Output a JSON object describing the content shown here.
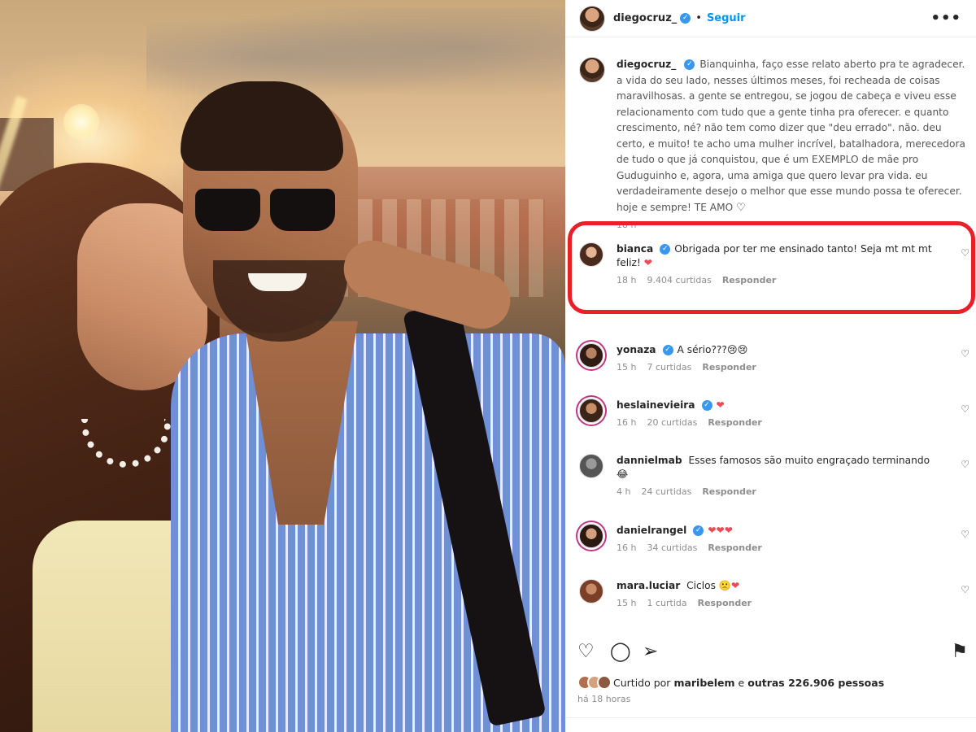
{
  "post": {
    "author": "diegocruz_",
    "follow_label": "Seguir",
    "separator": "•",
    "more": "•••",
    "caption": {
      "username": "diegocruz_",
      "text": "Bianquinha, faço esse relato aberto pra te agradecer. a vida do seu lado, nesses últimos meses, foi recheada de coisas maravilhosas. a gente se entregou, se jogou de cabeça e viveu esse relacionamento com tudo que a gente tinha pra oferecer. e quanto crescimento, né? não tem como dizer que \"deu errado\". não. deu certo, e muito! te acho uma mulher incrível, batalhadora, merecedora de tudo o que já conquistou, que é um EXEMPLO de mãe pro Guduguinho e, agora, uma amiga que quero levar pra vida. eu verdadeiramente desejo o melhor que esse mundo possa te oferecer. hoje e sempre! TE AMO",
      "heart": "♡",
      "time": "18 h"
    }
  },
  "comments": [
    {
      "username": "bianca",
      "verified": true,
      "text": "Obrigada por ter me ensinado tanto! Seja mt mt mt feliz!",
      "emoji": "❤",
      "time": "18 h",
      "likes": "9.404 curtidas",
      "reply": "Responder"
    },
    {
      "username": "yonaza",
      "verified": true,
      "text": "A sério???",
      "emoji": "😢😢",
      "time": "15 h",
      "likes": "7 curtidas",
      "reply": "Responder"
    },
    {
      "username": "heslainevieira",
      "verified": true,
      "text": "",
      "emoji": "❤",
      "time": "16 h",
      "likes": "20 curtidas",
      "reply": "Responder"
    },
    {
      "username": "dannielmab",
      "verified": false,
      "text": "Esses famosos são muito engraçado terminando",
      "emoji": "😂",
      "time": "4 h",
      "likes": "24 curtidas",
      "reply": "Responder"
    },
    {
      "username": "danielrangel",
      "verified": true,
      "text": "",
      "emoji": "❤❤❤",
      "time": "16 h",
      "likes": "34 curtidas",
      "reply": "Responder"
    },
    {
      "username": "mara.luciar",
      "verified": false,
      "text": "Ciclos",
      "emoji": "🙁❤",
      "time": "15 h",
      "likes": "1 curtida",
      "reply": "Responder"
    }
  ],
  "comment_heart": "♡",
  "actions": {
    "like": "♡",
    "comment": "◯",
    "share": "➢",
    "save": "⚑"
  },
  "likes_line": {
    "prefix": "Curtido por",
    "user": "maribelem",
    "middle": "e",
    "others": "outras 226.906 pessoas"
  },
  "posted_time": "há 18 horas",
  "colors": {
    "verified": "#3897f0",
    "follow": "#0095f6",
    "highlight": "#e8202a",
    "heart_red": "#ed4956"
  }
}
